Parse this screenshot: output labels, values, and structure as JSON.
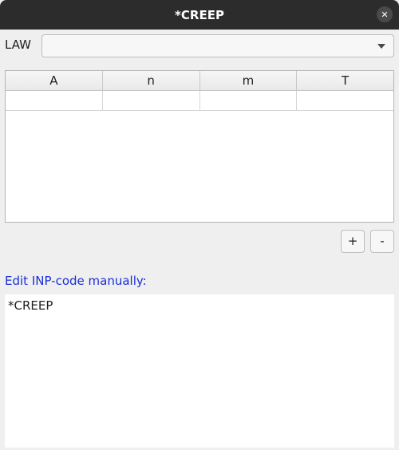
{
  "window": {
    "title": "*CREEP",
    "close_glyph": "✕"
  },
  "law": {
    "label": "LAW",
    "selected": ""
  },
  "table": {
    "columns": [
      "A",
      "n",
      "m",
      "T"
    ],
    "rows": [
      [
        "",
        "",
        "",
        ""
      ]
    ]
  },
  "buttons": {
    "add_label": "+",
    "remove_label": "-"
  },
  "editor": {
    "label": "Edit INP-code manually:",
    "content": "*CREEP"
  },
  "colors": {
    "titlebar": "#2c2c2c",
    "link_label": "#1b2fd6",
    "background": "#efefef"
  }
}
